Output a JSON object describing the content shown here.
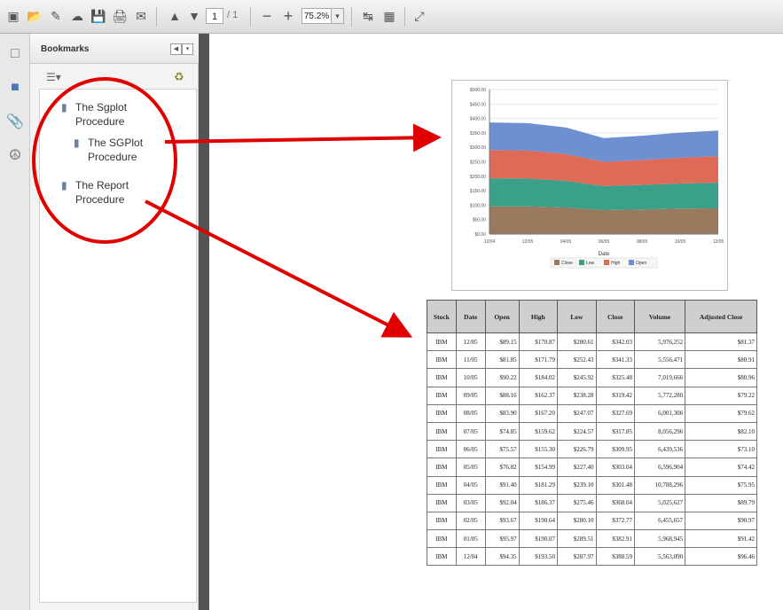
{
  "toolbar": {
    "buttons": [
      "create-icon",
      "open-icon",
      "edit-icon",
      "upload-icon",
      "save-icon",
      "print-icon",
      "email-icon",
      "prev-page-icon",
      "next-page-icon",
      "zoom-out-icon",
      "zoom-in-icon",
      "fit-width-icon",
      "fit-page-icon",
      "fullscreen-icon"
    ],
    "page_current": "1",
    "page_total": "/ 1",
    "zoom_value": "75.2%"
  },
  "sidebar": {
    "title": "Bookmarks",
    "bookmarks": [
      {
        "label": "The Sgplot Procedure",
        "level": 0
      },
      {
        "label": "The SGPlot Procedure",
        "level": 1
      },
      {
        "label": "The Report Procedure",
        "level": 0
      }
    ]
  },
  "chart_data": {
    "type": "area",
    "x": [
      "12/04",
      "12/05",
      "04/05",
      "06/05",
      "08/05",
      "10/05",
      "12/05"
    ],
    "xlabel": "Date",
    "ylabel": "",
    "ylim": [
      0,
      500
    ],
    "y_tick_labels": [
      "$0.00",
      "$50.00",
      "$100.00",
      "$150.00",
      "$200.00",
      "$250.00",
      "$300.00",
      "$350.00",
      "$400.00",
      "$450.00",
      "$500.00"
    ],
    "series": [
      {
        "name": "Close",
        "color": "#9a7a5e",
        "values": [
          96,
          96,
          92,
          83,
          85,
          88,
          89
        ]
      },
      {
        "name": "Low",
        "color": "#3aa08a",
        "values": [
          97,
          96,
          92,
          83,
          85,
          87,
          89
        ]
      },
      {
        "name": "High",
        "color": "#dd6b58",
        "values": [
          98,
          97,
          93,
          84,
          86,
          89,
          91
        ]
      },
      {
        "name": "Open",
        "color": "#6e8fd0",
        "values": [
          95,
          95,
          92,
          82,
          84,
          87,
          89
        ]
      }
    ],
    "legend": [
      "Close",
      "Low",
      "High",
      "Open"
    ],
    "legend_position": "bottom",
    "grid": true
  },
  "report": {
    "columns": [
      "Stock",
      "Date",
      "Open",
      "High",
      "Low",
      "Close",
      "Volume",
      "Adjusted Close"
    ],
    "rows": [
      [
        "IBM",
        "12/05",
        "$89.15",
        "$170.87",
        "$280.61",
        "$342.03",
        "5,976,252",
        "$81.37"
      ],
      [
        "IBM",
        "11/05",
        "$81.85",
        "$171.79",
        "$252.43",
        "$341.33",
        "5,556,471",
        "$80.91"
      ],
      [
        "IBM",
        "10/05",
        "$90.22",
        "$184.02",
        "$245.92",
        "$325.48",
        "7,019,666",
        "$80.96"
      ],
      [
        "IBM",
        "09/05",
        "$88.16",
        "$162.37",
        "$238.28",
        "$319.42",
        "5,772,280",
        "$79.22"
      ],
      [
        "IBM",
        "08/05",
        "$83.90",
        "$167.20",
        "$247.07",
        "$327.69",
        "6,001,306",
        "$79.62"
      ],
      [
        "IBM",
        "07/05",
        "$74.85",
        "$159.62",
        "$224.57",
        "$317.85",
        "8,056,296",
        "$82.10"
      ],
      [
        "IBM",
        "06/05",
        "$75.57",
        "$155.30",
        "$226.79",
        "$309.95",
        "6,439,536",
        "$73.10"
      ],
      [
        "IBM",
        "05/05",
        "$76.82",
        "$154.99",
        "$227.40",
        "$303.04",
        "6,596,904",
        "$74.42"
      ],
      [
        "IBM",
        "04/05",
        "$91.40",
        "$181.29",
        "$239.10",
        "$301.48",
        "10,788,296",
        "$75.95"
      ],
      [
        "IBM",
        "03/05",
        "$92.04",
        "$186.37",
        "$275.46",
        "$368.04",
        "5,025,627",
        "$89.79"
      ],
      [
        "IBM",
        "02/05",
        "$93.67",
        "$190.64",
        "$280.10",
        "$372.77",
        "6,455,657",
        "$90.97"
      ],
      [
        "IBM",
        "01/05",
        "$95.97",
        "$190.07",
        "$289.51",
        "$382.91",
        "5,968,945",
        "$91.42"
      ],
      [
        "IBM",
        "12/04",
        "$94.35",
        "$193.50",
        "$287.97",
        "$388.59",
        "5,563,090",
        "$96.46"
      ]
    ]
  }
}
